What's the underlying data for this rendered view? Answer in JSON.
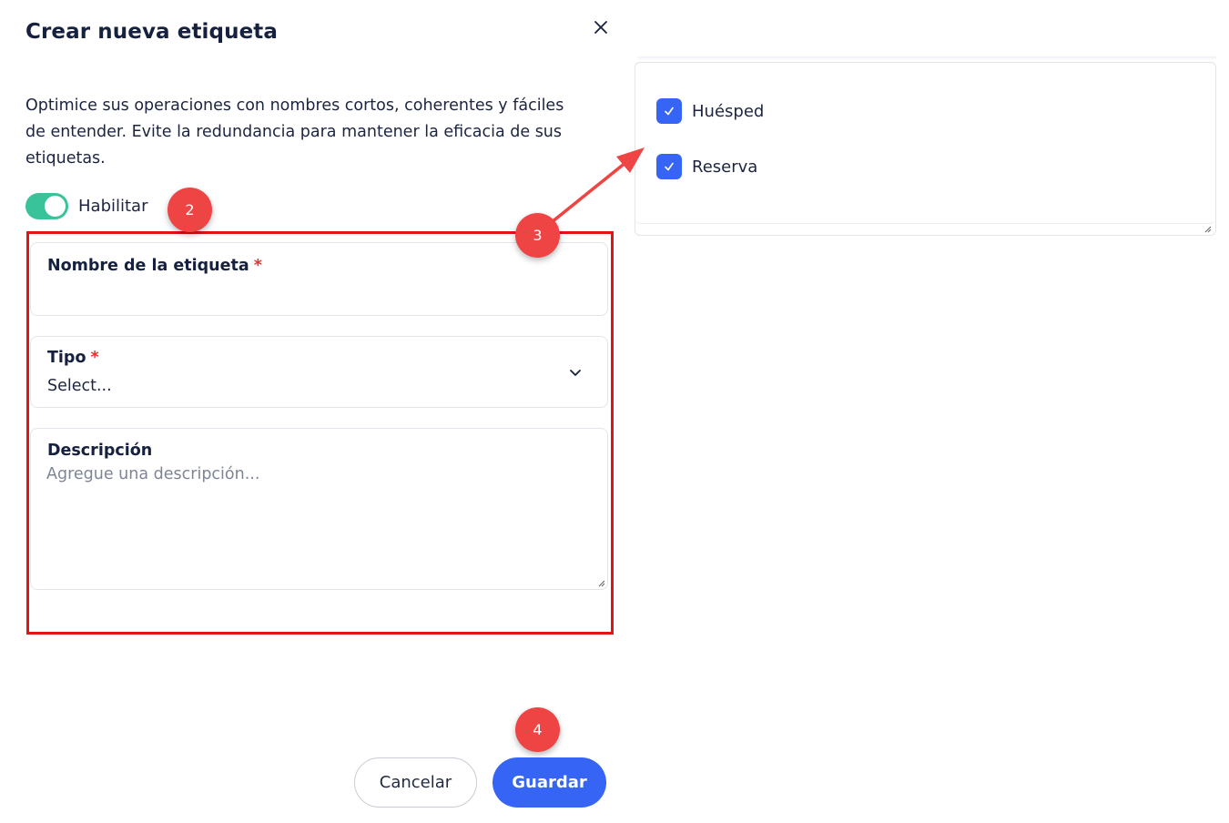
{
  "dialog": {
    "title": "Crear nueva etiqueta",
    "description": "Optimice sus operaciones con nombres cortos, coherentes y fáciles de entender. Evite la redundancia para mantener la eficacia de sus etiquetas.",
    "close_icon": "close-icon"
  },
  "toggle": {
    "label": "Habilitar",
    "enabled": true,
    "color": "#38c39a"
  },
  "form": {
    "name_label": "Nombre de la etiqueta",
    "name_value": "",
    "type_label": "Tipo",
    "type_value": "Select...",
    "description_label": "Descripción",
    "description_placeholder": "Agregue una descripción...",
    "required_mark": "*"
  },
  "type_options": [
    {
      "label": "Huésped",
      "checked": true
    },
    {
      "label": "Reserva",
      "checked": true
    }
  ],
  "annotations": {
    "badge_2": "2",
    "badge_3": "3",
    "badge_4": "4",
    "badge_color": "#ef4444",
    "highlight_color": "#e01414"
  },
  "footer": {
    "cancel_label": "Cancelar",
    "save_label": "Guardar",
    "accent": "#3664f4"
  }
}
